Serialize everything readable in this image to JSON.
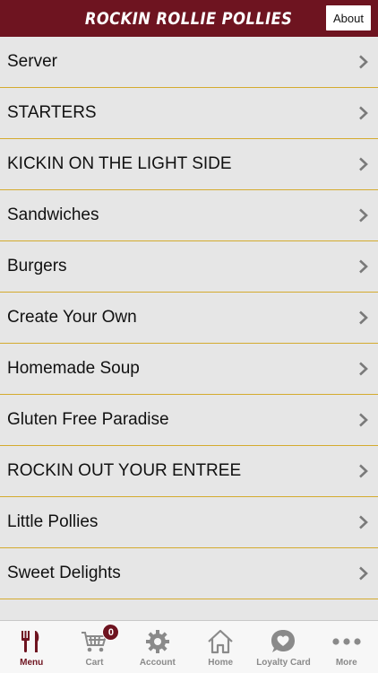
{
  "header": {
    "title": "ROCKIN ROLLIE POLLIES",
    "about_label": "About"
  },
  "menu": {
    "items": [
      {
        "label": "Server"
      },
      {
        "label": "STARTERS"
      },
      {
        "label": "KICKIN ON THE LIGHT SIDE"
      },
      {
        "label": "Sandwiches"
      },
      {
        "label": "Burgers"
      },
      {
        "label": "Create Your Own"
      },
      {
        "label": "Homemade Soup"
      },
      {
        "label": "Gluten Free Paradise"
      },
      {
        "label": "ROCKIN OUT YOUR ENTREE"
      },
      {
        "label": "Little Pollies"
      },
      {
        "label": "Sweet Delights"
      }
    ]
  },
  "tabs": {
    "menu": "Menu",
    "cart": "Cart",
    "cart_count": "0",
    "account": "Account",
    "home": "Home",
    "loyalty": "Loyalty Card",
    "more": "More"
  },
  "colors": {
    "brand": "#6e1420",
    "divider": "#d4ab2f",
    "list_bg": "#e6e6e6"
  },
  "icons": [
    "fork-knife-icon",
    "cart-icon",
    "gear-icon",
    "home-icon",
    "heart-badge-icon",
    "more-dots-icon",
    "chevron-right-icon"
  ]
}
